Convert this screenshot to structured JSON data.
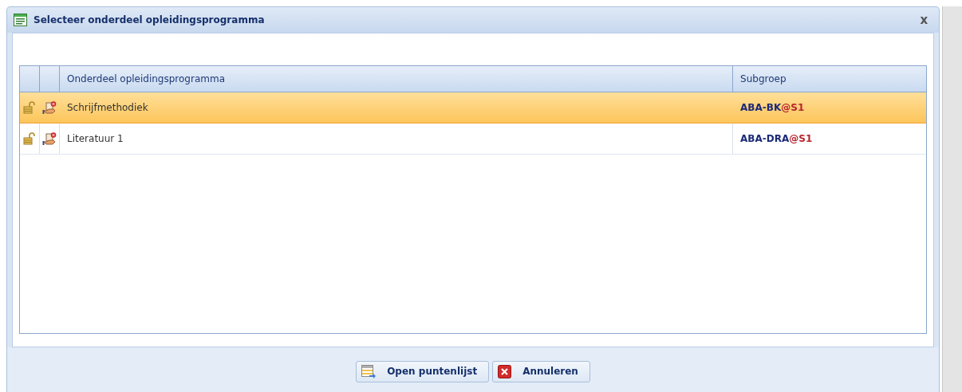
{
  "window": {
    "title": "Selecteer onderdeel opleidingsprogramma",
    "close": "x"
  },
  "table": {
    "columns": [
      "Onderdeel opleidingsprogramma",
      "Subgroep"
    ],
    "rows": [
      {
        "name": "Schrijfmethodiek",
        "subgroup": "ABA-BK",
        "suffix": "@S1",
        "selected": true
      },
      {
        "name": "Literatuur 1",
        "subgroup": "ABA-DRA",
        "suffix": "@S1",
        "selected": false
      }
    ]
  },
  "buttons": [
    {
      "label": "Open puntenlijst",
      "kind": "open"
    },
    {
      "label": "Annuleren",
      "kind": "cancel"
    }
  ]
}
